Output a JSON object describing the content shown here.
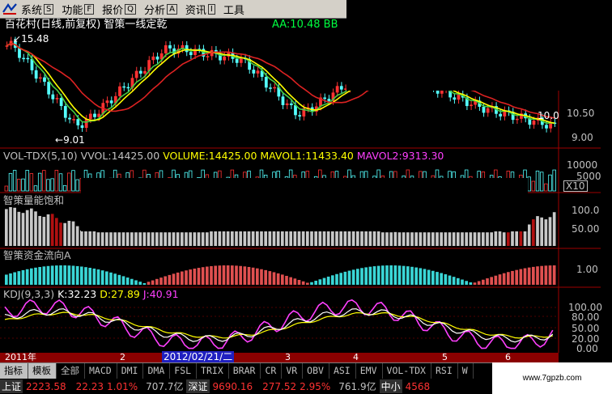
{
  "menu": {
    "items": [
      {
        "label": "系统",
        "key": "S"
      },
      {
        "label": "功能",
        "key": "F"
      },
      {
        "label": "报价",
        "key": "Q"
      },
      {
        "label": "分析",
        "key": "A"
      },
      {
        "label": "资讯",
        "key": "I"
      },
      {
        "label": "工具",
        "key": ""
      }
    ]
  },
  "main_panel": {
    "title": "百花村(日线,前复权) 智策一线定乾",
    "aa_label": "AA:10.48 BB",
    "high_mark": "15.48",
    "low_mark": "9.01",
    "right_mark": "10.0",
    "y_ticks": [
      "10.50",
      "9.00"
    ]
  },
  "vol_panel": {
    "title_prefix": "VOL-TDX(5,10)",
    "vvol": "VVOL:14425.00",
    "volume": "VOLUME:14425.00",
    "mavol1": "MAVOL1:11433.40",
    "mavol2": "MAVOL2:9313.30",
    "y_ticks": [
      "10000",
      "5000"
    ],
    "unit": "X10"
  },
  "energy_panel": {
    "title": "智策量能饱和",
    "y_ticks": [
      "100.0",
      "50.00"
    ]
  },
  "flow_panel": {
    "title": "智策资金流向A",
    "y_ticks": [
      "1.00"
    ]
  },
  "kdj_panel": {
    "title": "KDJ(9,3,3)",
    "k": "K:32.23",
    "d": "D:27.89",
    "j": "J:40.91",
    "y_ticks": [
      "100.00",
      "80.00",
      "50.00",
      "20.00",
      "0.00"
    ]
  },
  "time_axis": {
    "labels": [
      {
        "text": "2011年",
        "x": 6
      },
      {
        "text": "2",
        "x": 148
      },
      {
        "text": "3",
        "x": 352
      },
      {
        "text": "4",
        "x": 436
      },
      {
        "text": "5",
        "x": 546
      },
      {
        "text": "6",
        "x": 624
      }
    ],
    "highlight": "2012/02/21/二"
  },
  "bottom_tabs": [
    "指标",
    "模板",
    "全部",
    "MACD",
    "DMI",
    "DMA",
    "FSL",
    "TRIX",
    "BRAR",
    "CR",
    "VR",
    "OBV",
    "ASI",
    "EMV",
    "VOL-TDX",
    "RSI",
    "W"
  ],
  "status": {
    "sh_label": "上证",
    "sh_index": "2223.58",
    "sh_change": "22.23",
    "sh_pct": "1.01%",
    "sh_amount": "707.7亿",
    "sz_label": "深证",
    "sz_index": "9690.16",
    "sz_change": "277.52",
    "sz_pct": "2.95%",
    "sz_amount": "761.9亿",
    "zx_label": "中小",
    "zx_index": "4568"
  },
  "watermark": "www.7gpzb.com",
  "colors": {
    "up": "#ff3232",
    "down": "#54ffff",
    "ma_red": "#dd2222",
    "ma_yellow": "#ffff00",
    "ma_green": "#44cc44",
    "k": "#ffffff",
    "d": "#ffff00",
    "j": "#ff40ff",
    "axis": "#b00000",
    "grid_text": "#c0c0c0"
  }
}
